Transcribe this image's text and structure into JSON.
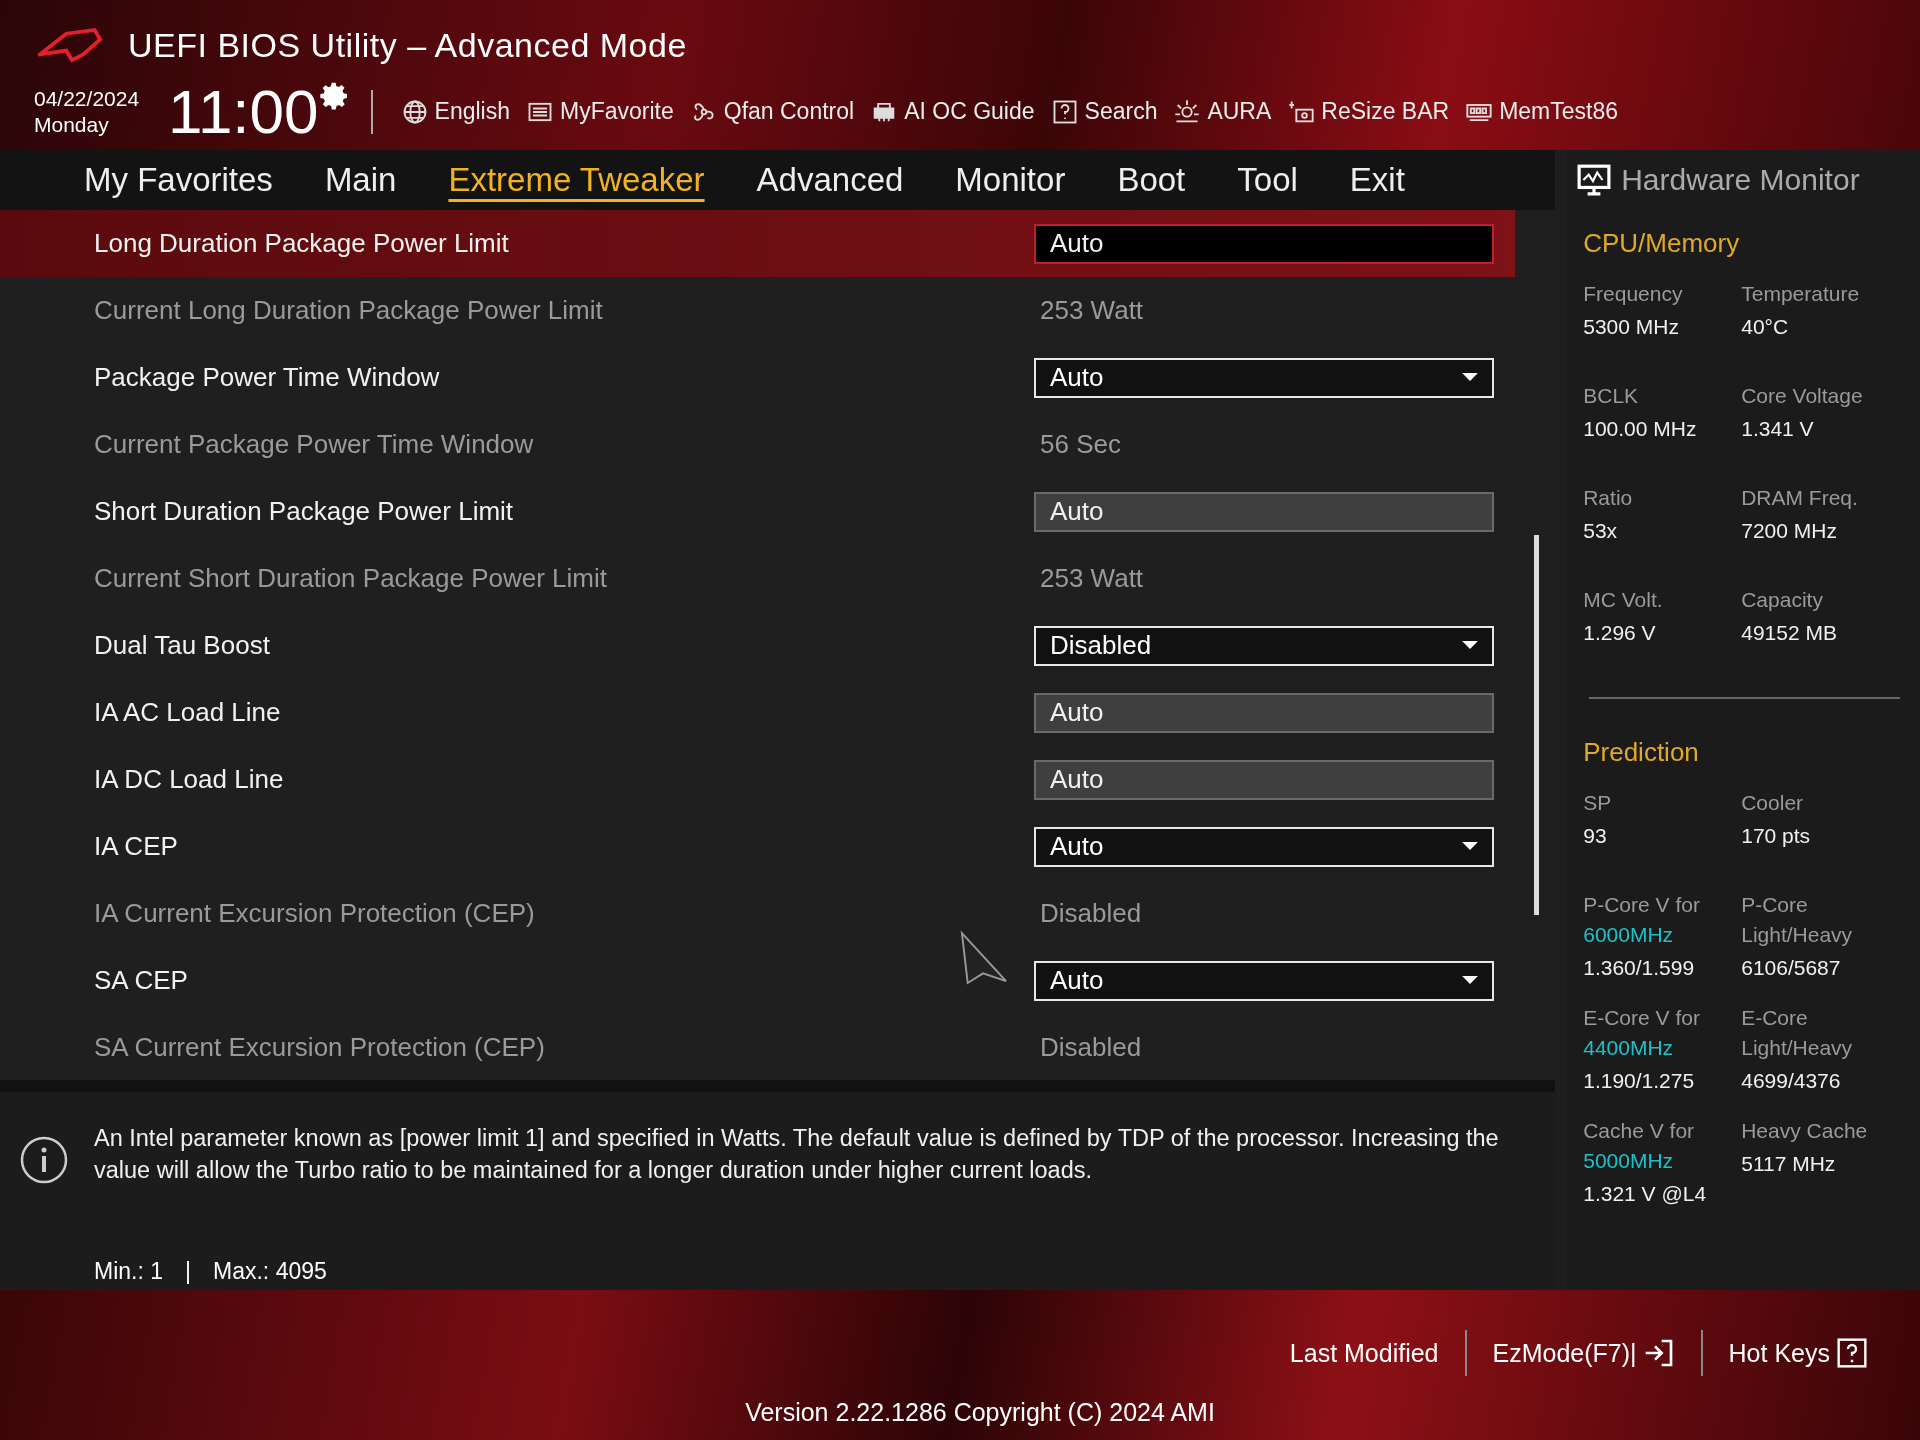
{
  "header": {
    "title": "UEFI BIOS Utility – Advanced Mode",
    "date": "04/22/2024",
    "weekday": "Monday",
    "time": "11:00"
  },
  "toolbar": [
    {
      "label": "English",
      "kind": "globe"
    },
    {
      "label": "MyFavorite",
      "kind": "list"
    },
    {
      "label": "Qfan Control",
      "kind": "fan"
    },
    {
      "label": "AI OC Guide",
      "kind": "chip"
    },
    {
      "label": "Search",
      "kind": "help"
    },
    {
      "label": "AURA",
      "kind": "light"
    },
    {
      "label": "ReSize BAR",
      "kind": "card"
    },
    {
      "label": "MemTest86",
      "kind": "memory"
    }
  ],
  "tabs": [
    {
      "label": "My Favorites",
      "selected": false
    },
    {
      "label": "Main",
      "selected": false
    },
    {
      "label": "Extreme Tweaker",
      "selected": true
    },
    {
      "label": "Advanced",
      "selected": false
    },
    {
      "label": "Monitor",
      "selected": false
    },
    {
      "label": "Boot",
      "selected": false
    },
    {
      "label": "Tool",
      "selected": false
    },
    {
      "label": "Exit",
      "selected": false
    }
  ],
  "settings": [
    {
      "label": "Long Duration Package Power Limit",
      "kind": "input",
      "value": "Auto",
      "selected": true
    },
    {
      "label": "Current Long Duration Package Power Limit",
      "kind": "info",
      "value": "253 Watt",
      "selected": false
    },
    {
      "label": "Package Power Time Window",
      "kind": "dropdown",
      "value": "Auto",
      "selected": false
    },
    {
      "label": "Current Package Power Time Window",
      "kind": "info",
      "value": "56 Sec",
      "selected": false
    },
    {
      "label": "Short Duration Package Power Limit",
      "kind": "input",
      "value": "Auto",
      "selected": false
    },
    {
      "label": "Current Short Duration Package Power Limit",
      "kind": "info",
      "value": "253 Watt",
      "selected": false
    },
    {
      "label": "Dual Tau Boost",
      "kind": "dropdown",
      "value": "Disabled",
      "selected": false
    },
    {
      "label": "IA AC Load Line",
      "kind": "input",
      "value": "Auto",
      "selected": false
    },
    {
      "label": "IA DC Load Line",
      "kind": "input",
      "value": "Auto",
      "selected": false
    },
    {
      "label": "IA CEP",
      "kind": "dropdown",
      "value": "Auto",
      "selected": false
    },
    {
      "label": "IA Current Excursion Protection (CEP)",
      "kind": "info",
      "value": "Disabled",
      "selected": false
    },
    {
      "label": "SA CEP",
      "kind": "dropdown",
      "value": "Auto",
      "selected": false
    },
    {
      "label": "SA Current Excursion Protection (CEP)",
      "kind": "info",
      "value": "Disabled",
      "selected": false
    }
  ],
  "help": {
    "text": "An Intel parameter known as [power limit 1] and specified in Watts. The default value is defined by TDP of the processor. Increasing the value will allow the Turbo ratio to be maintained for a longer duration under higher current loads.",
    "min": "Min.: 1",
    "separator": "|",
    "max": "Max.: 4095"
  },
  "hardware_monitor": {
    "title": "Hardware Monitor",
    "sections": [
      {
        "title": "CPU/Memory",
        "items": [
          {
            "label": "Frequency",
            "value": "5300 MHz"
          },
          {
            "label": "Temperature",
            "value": "40°C"
          },
          {
            "label": "BCLK",
            "value": "100.00 MHz"
          },
          {
            "label": "Core Voltage",
            "value": "1.341 V"
          },
          {
            "label": "Ratio",
            "value": "53x"
          },
          {
            "label": "DRAM Freq.",
            "value": "7200 MHz"
          },
          {
            "label": "MC Volt.",
            "value": "1.296 V"
          },
          {
            "label": "Capacity",
            "value": "49152 MB"
          }
        ]
      },
      {
        "title": "Prediction",
        "items": [
          {
            "label": "SP",
            "value": "93"
          },
          {
            "label": "Cooler",
            "value": "170 pts"
          },
          {
            "label": "P-Core V for",
            "highlight": "6000MHz",
            "value": "1.360/1.599"
          },
          {
            "label": "P-Core Light/Heavy",
            "value": "6106/5687"
          },
          {
            "label": "E-Core V for",
            "highlight": "4400MHz",
            "value": "1.190/1.275"
          },
          {
            "label": "E-Core Light/Heavy",
            "value": "4699/4376"
          },
          {
            "label": "Cache V for",
            "highlight": "5000MHz",
            "value": "1.321 V @L4"
          },
          {
            "label": "Heavy Cache",
            "value": "5117 MHz"
          }
        ]
      }
    ]
  },
  "footer": {
    "buttons": [
      "Last Modified",
      "EzMode(F7)|",
      "Hot Keys"
    ],
    "version": "Version 2.22.1286 Copyright (C) 2024 AMI"
  }
}
